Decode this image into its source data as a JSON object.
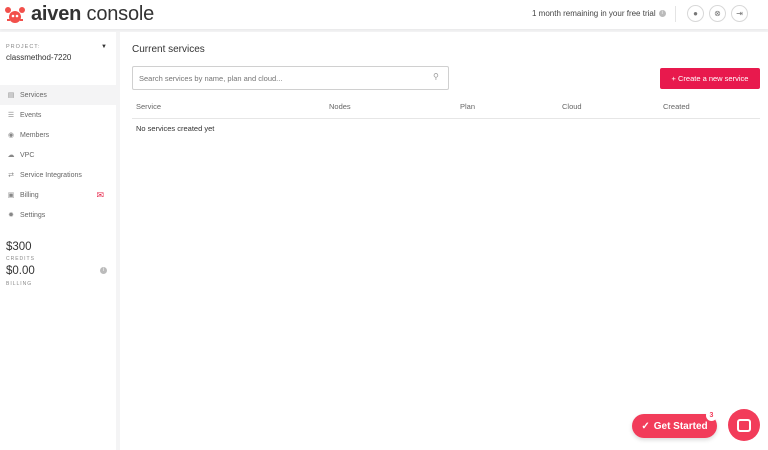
{
  "header": {
    "logo_bold": "aiven",
    "logo_light": " console",
    "trial": "1 month remaining in your free trial",
    "buttons": [
      "user-icon",
      "support-icon",
      "logout-icon"
    ]
  },
  "sidebar": {
    "project_label": "PROJECT:",
    "project_name": "classmethod-7220",
    "items": [
      {
        "label": "Services",
        "icon": "▤"
      },
      {
        "label": "Events",
        "icon": "☰"
      },
      {
        "label": "Members",
        "icon": "◉"
      },
      {
        "label": "VPC",
        "icon": "☁"
      },
      {
        "label": "Service Integrations",
        "icon": "⇄"
      },
      {
        "label": "Billing",
        "icon": "▣"
      },
      {
        "label": "Settings",
        "icon": "✹"
      }
    ],
    "credits": "$300",
    "credits_label": "CREDITS",
    "billing": "$0.00",
    "billing_label": "BILLING"
  },
  "main": {
    "title": "Current services",
    "search_placeholder": "Search services by name, plan and cloud...",
    "create_label": "+ Create a new service",
    "columns": [
      "Service",
      "Nodes",
      "Plan",
      "Cloud",
      "Created"
    ],
    "empty": "No services created yet"
  },
  "widgets": {
    "get_started": "Get Started",
    "badge": "3"
  },
  "colors": {
    "accent": "#e8194d"
  }
}
